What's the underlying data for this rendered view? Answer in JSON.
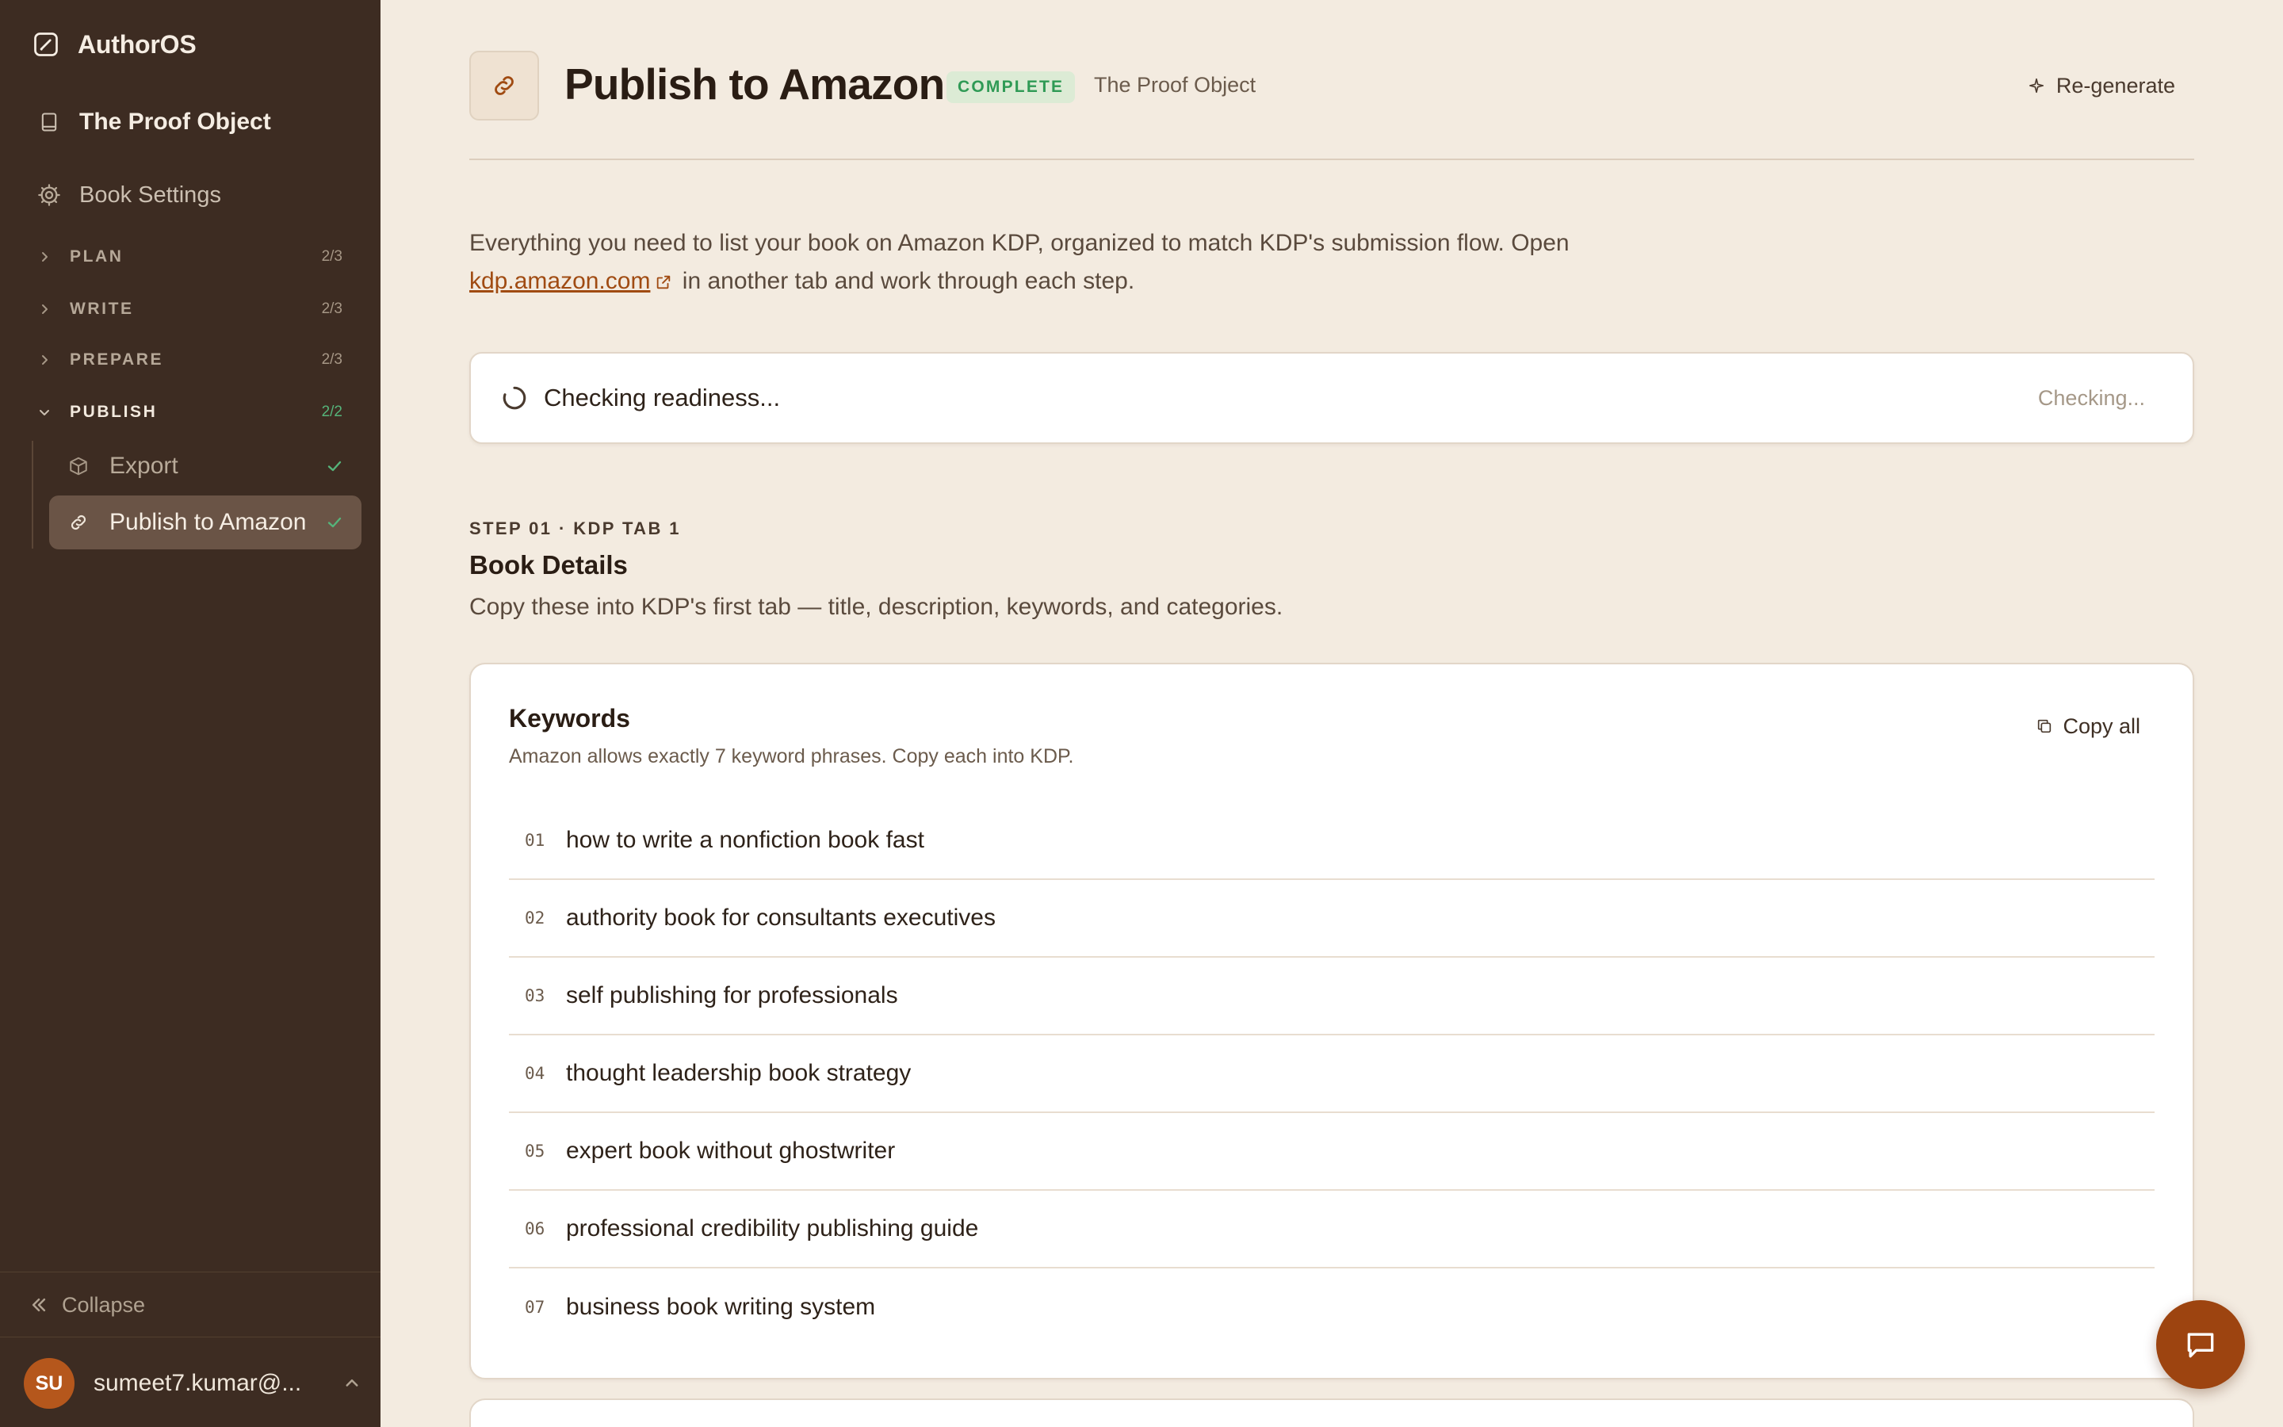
{
  "app": {
    "name": "AuthorOS"
  },
  "sidebar": {
    "book_title": "The Proof Object",
    "settings_label": "Book Settings",
    "sections": [
      {
        "label": "PLAN",
        "count": "2/3",
        "expanded": false
      },
      {
        "label": "WRITE",
        "count": "2/3",
        "expanded": false
      },
      {
        "label": "PREPARE",
        "count": "2/3",
        "expanded": false
      },
      {
        "label": "PUBLISH",
        "count": "2/2",
        "expanded": true
      }
    ],
    "publish_items": [
      {
        "label": "Export",
        "icon": "box-icon",
        "status": "check-icon",
        "active": false
      },
      {
        "label": "Publish to Amazon",
        "icon": "link-icon",
        "status": "check-icon",
        "active": true
      }
    ],
    "collapse_label": "Collapse",
    "user": {
      "initials": "SU",
      "email": "sumeet7.kumar@..."
    }
  },
  "header": {
    "title": "Publish to Amazon",
    "badge": "COMPLETE",
    "book": "The Proof Object",
    "regenerate_label": "Re-generate"
  },
  "intro": {
    "before_link": "Everything you need to list your book on Amazon KDP, organized to match KDP's submission flow. Open ",
    "link_text": "kdp.amazon.com",
    "after_link": " in another tab and work through each step."
  },
  "readiness": {
    "text": "Checking readiness...",
    "status": "Checking..."
  },
  "step": {
    "eyebrow": "STEP 01 · KDP TAB 1",
    "title": "Book Details",
    "description": "Copy these into KDP's first tab — title, description, keywords, and categories."
  },
  "keywords": {
    "title": "Keywords",
    "subtitle": "Amazon allows exactly 7 keyword phrases. Copy each into KDP.",
    "copy_all_label": "Copy all",
    "items": [
      {
        "num": "01",
        "text": "how to write a nonfiction book fast"
      },
      {
        "num": "02",
        "text": "authority book for consultants executives"
      },
      {
        "num": "03",
        "text": "self publishing for professionals"
      },
      {
        "num": "04",
        "text": "thought leadership book strategy"
      },
      {
        "num": "05",
        "text": "expert book without ghostwriter"
      },
      {
        "num": "06",
        "text": "professional credibility publishing guide"
      },
      {
        "num": "07",
        "text": "business book writing system"
      }
    ]
  },
  "colors": {
    "sidebar_bg": "#3d2c22",
    "page_bg": "#f3ebe0",
    "accent": "#9d4410",
    "success": "#2f9a55"
  }
}
